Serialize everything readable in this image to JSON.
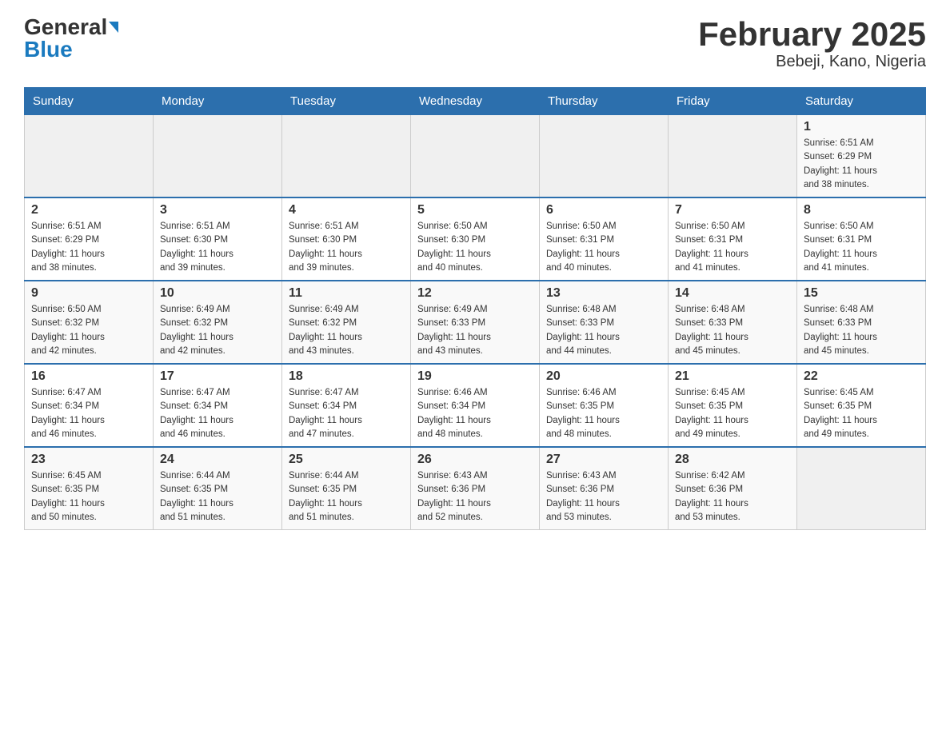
{
  "header": {
    "logo_general": "General",
    "logo_blue": "Blue",
    "title": "February 2025",
    "subtitle": "Bebeji, Kano, Nigeria"
  },
  "days_of_week": [
    "Sunday",
    "Monday",
    "Tuesday",
    "Wednesday",
    "Thursday",
    "Friday",
    "Saturday"
  ],
  "weeks": [
    {
      "days": [
        {
          "number": "",
          "info": ""
        },
        {
          "number": "",
          "info": ""
        },
        {
          "number": "",
          "info": ""
        },
        {
          "number": "",
          "info": ""
        },
        {
          "number": "",
          "info": ""
        },
        {
          "number": "",
          "info": ""
        },
        {
          "number": "1",
          "info": "Sunrise: 6:51 AM\nSunset: 6:29 PM\nDaylight: 11 hours\nand 38 minutes."
        }
      ]
    },
    {
      "days": [
        {
          "number": "2",
          "info": "Sunrise: 6:51 AM\nSunset: 6:29 PM\nDaylight: 11 hours\nand 38 minutes."
        },
        {
          "number": "3",
          "info": "Sunrise: 6:51 AM\nSunset: 6:30 PM\nDaylight: 11 hours\nand 39 minutes."
        },
        {
          "number": "4",
          "info": "Sunrise: 6:51 AM\nSunset: 6:30 PM\nDaylight: 11 hours\nand 39 minutes."
        },
        {
          "number": "5",
          "info": "Sunrise: 6:50 AM\nSunset: 6:30 PM\nDaylight: 11 hours\nand 40 minutes."
        },
        {
          "number": "6",
          "info": "Sunrise: 6:50 AM\nSunset: 6:31 PM\nDaylight: 11 hours\nand 40 minutes."
        },
        {
          "number": "7",
          "info": "Sunrise: 6:50 AM\nSunset: 6:31 PM\nDaylight: 11 hours\nand 41 minutes."
        },
        {
          "number": "8",
          "info": "Sunrise: 6:50 AM\nSunset: 6:31 PM\nDaylight: 11 hours\nand 41 minutes."
        }
      ]
    },
    {
      "days": [
        {
          "number": "9",
          "info": "Sunrise: 6:50 AM\nSunset: 6:32 PM\nDaylight: 11 hours\nand 42 minutes."
        },
        {
          "number": "10",
          "info": "Sunrise: 6:49 AM\nSunset: 6:32 PM\nDaylight: 11 hours\nand 42 minutes."
        },
        {
          "number": "11",
          "info": "Sunrise: 6:49 AM\nSunset: 6:32 PM\nDaylight: 11 hours\nand 43 minutes."
        },
        {
          "number": "12",
          "info": "Sunrise: 6:49 AM\nSunset: 6:33 PM\nDaylight: 11 hours\nand 43 minutes."
        },
        {
          "number": "13",
          "info": "Sunrise: 6:48 AM\nSunset: 6:33 PM\nDaylight: 11 hours\nand 44 minutes."
        },
        {
          "number": "14",
          "info": "Sunrise: 6:48 AM\nSunset: 6:33 PM\nDaylight: 11 hours\nand 45 minutes."
        },
        {
          "number": "15",
          "info": "Sunrise: 6:48 AM\nSunset: 6:33 PM\nDaylight: 11 hours\nand 45 minutes."
        }
      ]
    },
    {
      "days": [
        {
          "number": "16",
          "info": "Sunrise: 6:47 AM\nSunset: 6:34 PM\nDaylight: 11 hours\nand 46 minutes."
        },
        {
          "number": "17",
          "info": "Sunrise: 6:47 AM\nSunset: 6:34 PM\nDaylight: 11 hours\nand 46 minutes."
        },
        {
          "number": "18",
          "info": "Sunrise: 6:47 AM\nSunset: 6:34 PM\nDaylight: 11 hours\nand 47 minutes."
        },
        {
          "number": "19",
          "info": "Sunrise: 6:46 AM\nSunset: 6:34 PM\nDaylight: 11 hours\nand 48 minutes."
        },
        {
          "number": "20",
          "info": "Sunrise: 6:46 AM\nSunset: 6:35 PM\nDaylight: 11 hours\nand 48 minutes."
        },
        {
          "number": "21",
          "info": "Sunrise: 6:45 AM\nSunset: 6:35 PM\nDaylight: 11 hours\nand 49 minutes."
        },
        {
          "number": "22",
          "info": "Sunrise: 6:45 AM\nSunset: 6:35 PM\nDaylight: 11 hours\nand 49 minutes."
        }
      ]
    },
    {
      "days": [
        {
          "number": "23",
          "info": "Sunrise: 6:45 AM\nSunset: 6:35 PM\nDaylight: 11 hours\nand 50 minutes."
        },
        {
          "number": "24",
          "info": "Sunrise: 6:44 AM\nSunset: 6:35 PM\nDaylight: 11 hours\nand 51 minutes."
        },
        {
          "number": "25",
          "info": "Sunrise: 6:44 AM\nSunset: 6:35 PM\nDaylight: 11 hours\nand 51 minutes."
        },
        {
          "number": "26",
          "info": "Sunrise: 6:43 AM\nSunset: 6:36 PM\nDaylight: 11 hours\nand 52 minutes."
        },
        {
          "number": "27",
          "info": "Sunrise: 6:43 AM\nSunset: 6:36 PM\nDaylight: 11 hours\nand 53 minutes."
        },
        {
          "number": "28",
          "info": "Sunrise: 6:42 AM\nSunset: 6:36 PM\nDaylight: 11 hours\nand 53 minutes."
        },
        {
          "number": "",
          "info": ""
        }
      ]
    }
  ]
}
